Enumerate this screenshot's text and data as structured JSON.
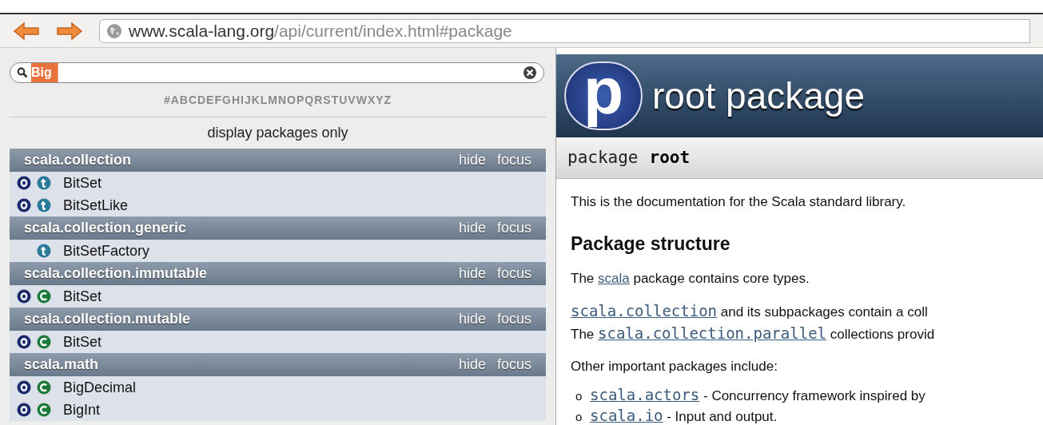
{
  "browser": {
    "url_host": "www.scala-lang.org",
    "url_path": "/api/current/index.html#package"
  },
  "sidebar": {
    "search": {
      "value": "Big"
    },
    "letters": "#ABCDEFGHIJKLMNOPQRSTUVWXYZ",
    "display_toggle": "display packages only",
    "packages": [
      {
        "name": "scala.collection",
        "hide": "hide",
        "focus": "focus",
        "entries": [
          {
            "name": "BitSet",
            "has_object": true,
            "kind": "trait"
          },
          {
            "name": "BitSetLike",
            "has_object": true,
            "kind": "trait"
          }
        ]
      },
      {
        "name": "scala.collection.generic",
        "hide": "hide",
        "focus": "focus",
        "entries": [
          {
            "name": "BitSetFactory",
            "has_object": false,
            "kind": "trait"
          }
        ]
      },
      {
        "name": "scala.collection.immutable",
        "hide": "hide",
        "focus": "focus",
        "entries": [
          {
            "name": "BitSet",
            "has_object": true,
            "kind": "class"
          }
        ]
      },
      {
        "name": "scala.collection.mutable",
        "hide": "hide",
        "focus": "focus",
        "entries": [
          {
            "name": "BitSet",
            "has_object": true,
            "kind": "class"
          }
        ]
      },
      {
        "name": "scala.math",
        "hide": "hide",
        "focus": "focus",
        "entries": [
          {
            "name": "BigDecimal",
            "has_object": true,
            "kind": "class"
          },
          {
            "name": "BigInt",
            "has_object": true,
            "kind": "class"
          }
        ]
      }
    ]
  },
  "content": {
    "logo_letter": "p",
    "title": "root package",
    "signature": {
      "keyword": "package",
      "name": "root"
    },
    "intro": "This is the documentation for the Scala standard library.",
    "heading": "Package structure",
    "paragraphs": [
      {
        "lines": [
          [
            {
              "kind": "text",
              "text": "The "
            },
            {
              "kind": "link",
              "text": "scala"
            },
            {
              "kind": "text",
              "text": " package contains core types."
            }
          ]
        ]
      },
      {
        "lines": [
          [
            {
              "kind": "code_link",
              "text": "scala.collection"
            },
            {
              "kind": "text",
              "text": " and its subpackages contain a coll"
            }
          ],
          [
            {
              "kind": "text",
              "text": "The "
            },
            {
              "kind": "code_link",
              "text": "scala.collection.parallel"
            },
            {
              "kind": "text",
              "text": " collections provid"
            }
          ]
        ]
      },
      {
        "lines": [
          [
            {
              "kind": "text",
              "text": "Other important packages include:"
            }
          ]
        ]
      }
    ],
    "bullets": [
      {
        "marker": "o",
        "parts": [
          {
            "kind": "code_link",
            "text": "scala.actors"
          },
          {
            "kind": "text",
            "text": " - Concurrency framework inspired by"
          }
        ]
      },
      {
        "marker": "o",
        "parts": [
          {
            "kind": "code_link",
            "text": "scala.io"
          },
          {
            "kind": "text",
            "text": " - Input and output."
          }
        ]
      }
    ]
  }
}
